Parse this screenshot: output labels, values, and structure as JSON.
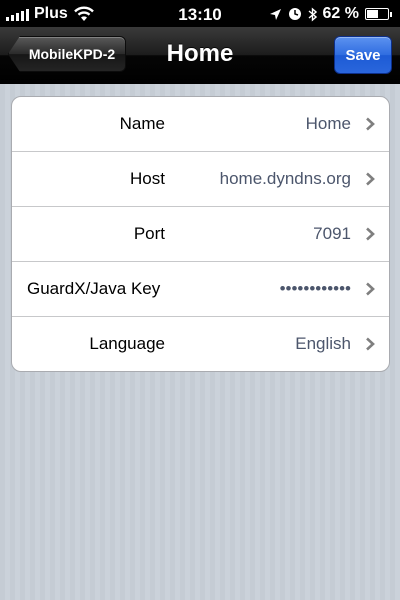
{
  "status_bar": {
    "carrier": "Plus",
    "time": "13:10",
    "battery": "62 %",
    "battery_level": 0.62
  },
  "nav": {
    "back_label": "MobileKPD-2",
    "title": "Home",
    "save_label": "Save"
  },
  "rows": [
    {
      "label": "Name",
      "value": "Home"
    },
    {
      "label": "Host",
      "value": "home.dyndns.org"
    },
    {
      "label": "Port",
      "value": "7091"
    },
    {
      "label": "GuardX/Java Key",
      "value": "••••••••••••"
    },
    {
      "label": "Language",
      "value": "English"
    }
  ]
}
